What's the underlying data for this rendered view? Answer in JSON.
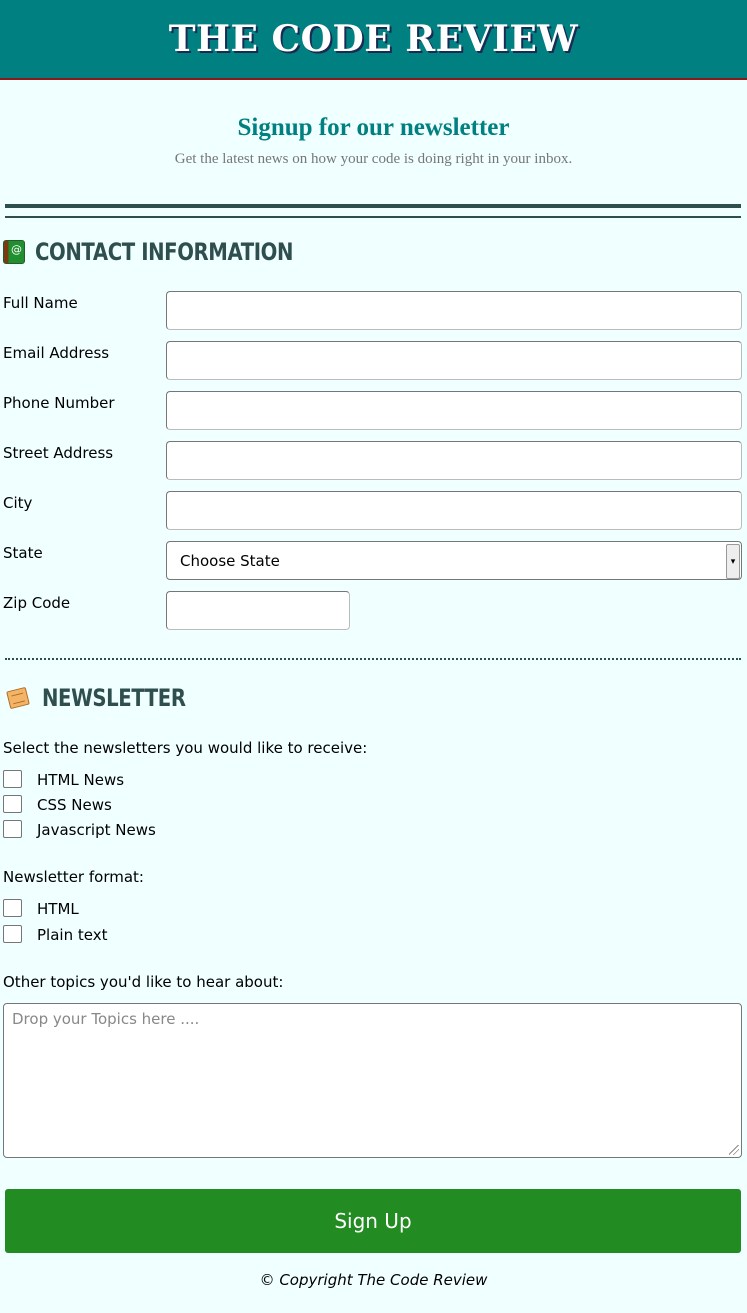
{
  "header": {
    "title": "THE CODE REVIEW"
  },
  "intro": {
    "title": "Signup for our newsletter",
    "subtitle": "Get the latest news on how your code is doing right in your inbox."
  },
  "contact": {
    "heading": "CONTACT INFORMATION",
    "icon": "address-book-icon",
    "full_name_label": "Full Name",
    "full_name_value": "",
    "email_label": "Email Address",
    "email_value": "",
    "phone_label": "Phone Number",
    "phone_value": "",
    "street_label": "Street Address",
    "street_value": "",
    "city_label": "City",
    "city_value": "",
    "state_label": "State",
    "state_selected": "Choose State",
    "zip_label": "Zip Code",
    "zip_value": ""
  },
  "newsletter": {
    "heading": "NEWSLETTER",
    "icon": "notepad-icon",
    "select_prompt": "Select the newsletters you would like to receive:",
    "options": [
      {
        "label": "HTML News",
        "checked": false
      },
      {
        "label": "CSS News",
        "checked": false
      },
      {
        "label": "Javascript News",
        "checked": false
      }
    ],
    "format_prompt": "Newsletter format:",
    "formats": [
      {
        "label": "HTML",
        "checked": false
      },
      {
        "label": "Plain text",
        "checked": false
      }
    ],
    "topics_prompt": "Other topics you'd like to hear about:",
    "topics_placeholder": "Drop your Topics here ....",
    "topics_value": ""
  },
  "actions": {
    "signup_label": "Sign Up"
  },
  "footer": {
    "copyright": "© Copyright The Code Review"
  },
  "colors": {
    "header_bg": "#008080",
    "page_bg": "#f0ffff",
    "section_heading": "#2f4f4f",
    "signup_button": "#228b22"
  }
}
